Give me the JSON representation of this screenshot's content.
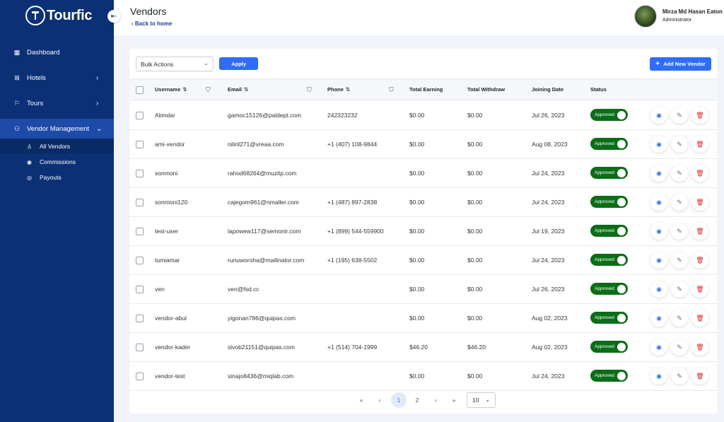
{
  "sidebar": {
    "logo": "Tourfic",
    "collapse_icon": "collapse-left-icon",
    "items": [
      {
        "label": "Dashboard",
        "icon": "dashboard-icon"
      },
      {
        "label": "Hotels",
        "icon": "hotel-icon"
      },
      {
        "label": "Tours",
        "icon": "flag-icon"
      },
      {
        "label": "Vendor Management",
        "icon": "vendor-icon"
      }
    ],
    "subitems": [
      {
        "label": "All Vendors",
        "icon": "user-icon"
      },
      {
        "label": "Commissions",
        "icon": "commission-icon"
      },
      {
        "label": "Payouts",
        "icon": "payout-icon"
      }
    ]
  },
  "header": {
    "title": "Vendors",
    "back_label": "Back to home",
    "user_name": "Mirza Md Hasan Eaton",
    "user_role": "Administrator"
  },
  "toolbar": {
    "bulk_actions": "Bulk Actions",
    "apply_label": "Apply",
    "add_label": "Add New Vendor"
  },
  "table": {
    "columns": {
      "username": "Username",
      "email": "Email",
      "phone": "Phone",
      "total_earning": "Total Earning",
      "total_withdraw": "Total Withdraw",
      "joining_date": "Joining Date",
      "status": "Status"
    },
    "rows": [
      {
        "username": "Alimdar",
        "email": "gamoc15126@paldept.com",
        "phone": "242323232",
        "earning": "$0.00",
        "withdraw": "$0.00",
        "date": "Jul 26, 2023",
        "status": "Approved"
      },
      {
        "username": "ami-vendor",
        "email": "niliril271@vreaa.com",
        "phone": "+1 (407) 108-9844",
        "earning": "$0.00",
        "withdraw": "$0.00",
        "date": "Aug 08, 2023",
        "status": "Approved"
      },
      {
        "username": "sonmoni",
        "email": "rahod68264@muzitp.com",
        "phone": "",
        "earning": "$0.00",
        "withdraw": "$0.00",
        "date": "Jul 24, 2023",
        "status": "Approved"
      },
      {
        "username": "sonmoni120",
        "email": "cajegom961@nmaller.com",
        "phone": "+1 (487) 897-2838",
        "earning": "$0.00",
        "withdraw": "$0.00",
        "date": "Jul 24, 2023",
        "status": "Approved"
      },
      {
        "username": "test-user",
        "email": "lapowew117@semonir.com",
        "phone": "+1 (899) 544-559900",
        "earning": "$0.00",
        "withdraw": "$0.00",
        "date": "Jul 19, 2023",
        "status": "Approved"
      },
      {
        "username": "tumiamar",
        "email": "runuworoha@mailinator.com",
        "phone": "+1 (195) 638-5502",
        "earning": "$0.00",
        "withdraw": "$0.00",
        "date": "Jul 24, 2023",
        "status": "Approved"
      },
      {
        "username": "ven",
        "email": "ven@fsd.cc",
        "phone": "",
        "earning": "$0.00",
        "withdraw": "$0.00",
        "date": "Jul 26, 2023",
        "status": "Approved"
      },
      {
        "username": "vendor-abul",
        "email": "yigonan786@quipas.com",
        "phone": "",
        "earning": "$0.00",
        "withdraw": "$0.00",
        "date": "Aug 02, 2023",
        "status": "Approved"
      },
      {
        "username": "vendor-kader",
        "email": "sivob21151@quipas.com",
        "phone": "+1 (514) 704-1999",
        "earning": "$46.20",
        "withdraw": "$46.20",
        "date": "Aug 02, 2023",
        "status": "Approved"
      },
      {
        "username": "vendor-test",
        "email": "sinajo8436@miqlab.com",
        "phone": "",
        "earning": "$0.00",
        "withdraw": "$0.00",
        "date": "Jul 24, 2023",
        "status": "Approved"
      }
    ]
  },
  "pagination": {
    "first": "«",
    "prev": "‹",
    "pages": [
      "1",
      "2"
    ],
    "current": "1",
    "next": "›",
    "last": "»",
    "per_page": "10"
  },
  "colors": {
    "sidebar_bg": "#0b3075",
    "primary": "#2f6df6",
    "approved": "#0b6d17",
    "delete": "#e02424"
  }
}
